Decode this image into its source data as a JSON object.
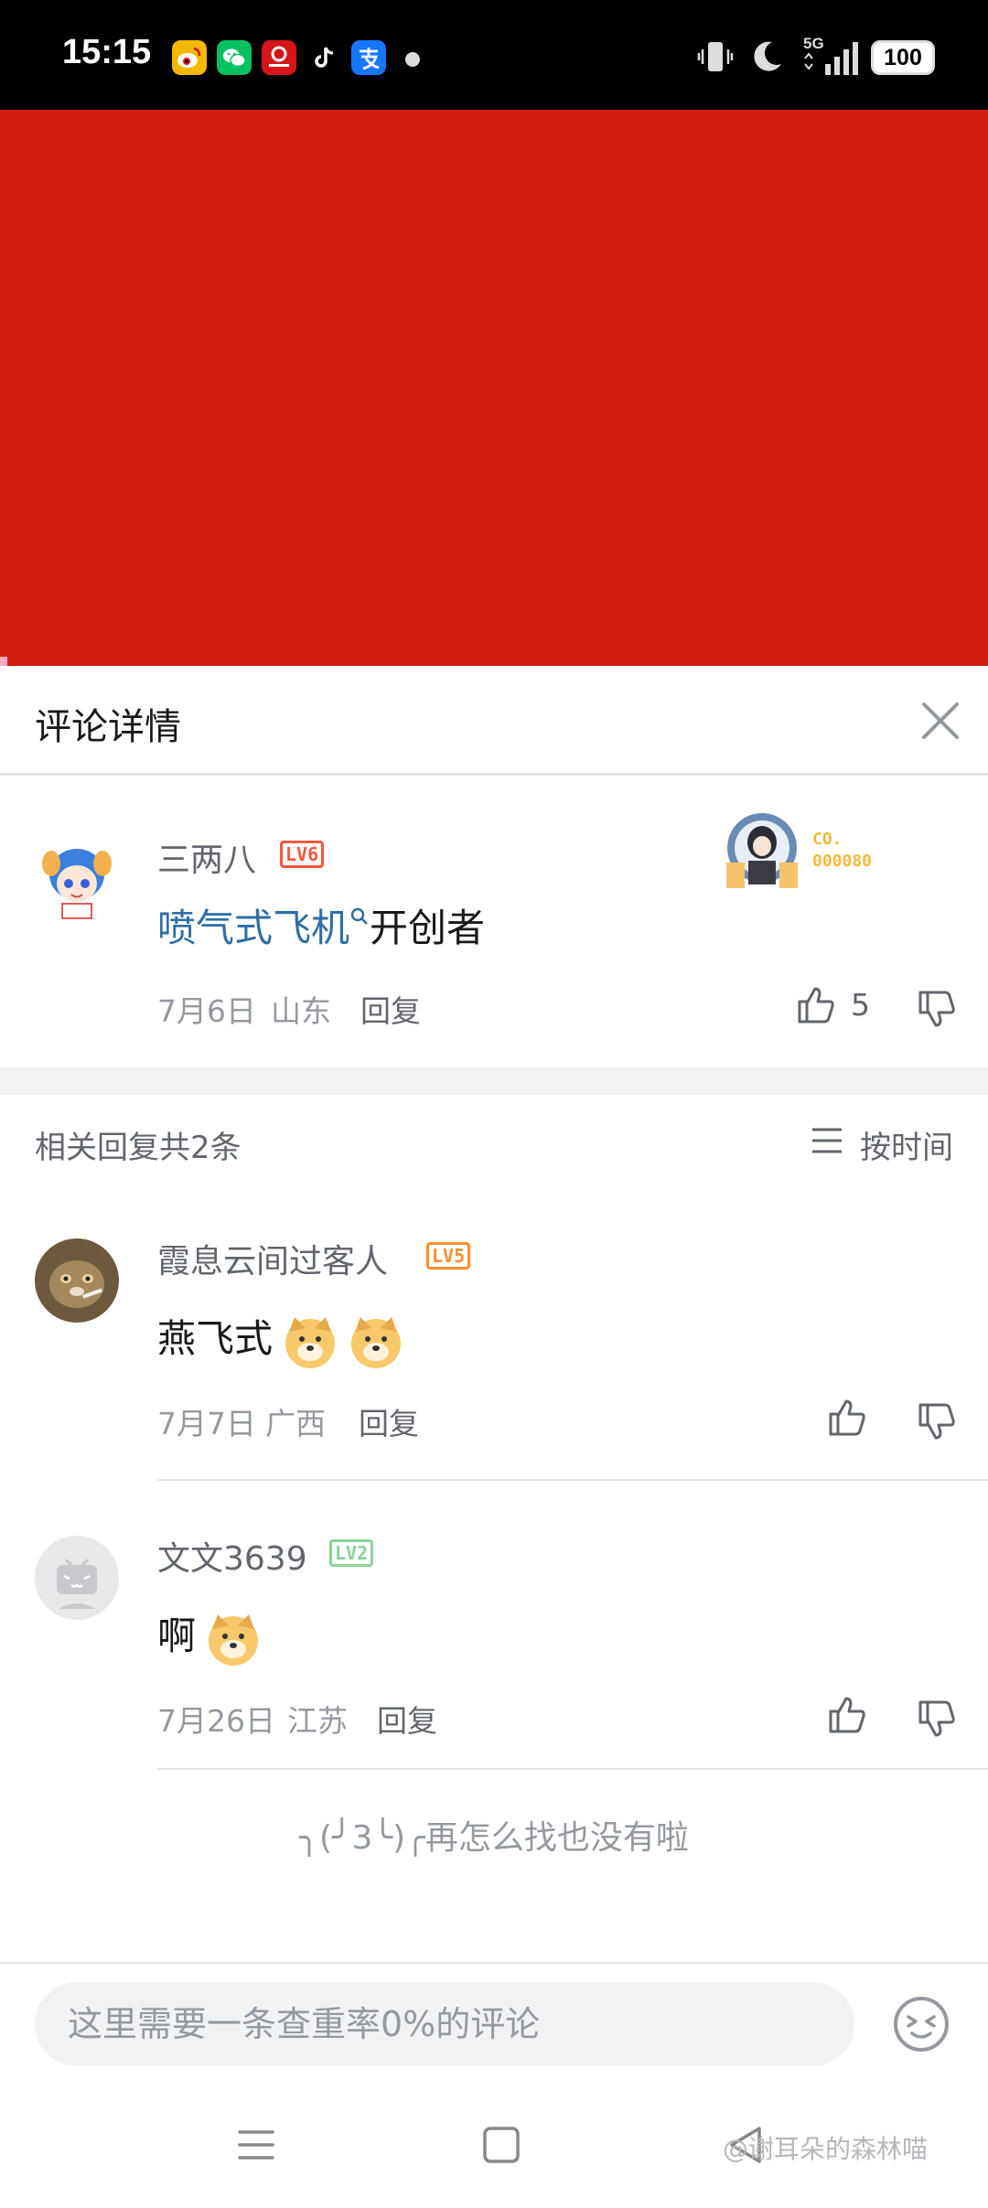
{
  "status_bar": {
    "time": "15:15",
    "network": "5G",
    "battery": "100",
    "app_icons": [
      {
        "name": "weibo-icon",
        "color": "#f5b800"
      },
      {
        "name": "wechat-icon",
        "color": "#07c160"
      },
      {
        "name": "news-app-icon",
        "color": "#d7141a"
      },
      {
        "name": "tiktok-icon",
        "color": "#000000"
      },
      {
        "name": "alipay-icon",
        "color": "#1677ff"
      }
    ]
  },
  "banner": {
    "color": "#d11a10"
  },
  "panel": {
    "title": "评论详情"
  },
  "main_comment": {
    "username": "三两八",
    "level": "LV6",
    "text_link": "喷气式飞机",
    "text_rest": "开创者",
    "date": "7月6日",
    "location": "山东",
    "reply_label": "回复",
    "likes": "5",
    "badge_text_1": "CO.",
    "badge_text_2": "000080"
  },
  "replies_header": {
    "count_text": "相关回复共2条",
    "sort_label": "按时间"
  },
  "replies": [
    {
      "username": "霞息云间过客人",
      "level": "LV5",
      "text": "燕飞式",
      "date": "7月7日",
      "location": "广西",
      "reply_label": "回复"
    },
    {
      "username": "文文3639",
      "level": "LV2",
      "text": "啊",
      "date": "7月26日",
      "location": "江苏",
      "reply_label": "回复"
    }
  ],
  "end_text": "╮(╯3╰)╭再怎么找也没有啦",
  "input": {
    "placeholder": "这里需要一条查重率0%的评论"
  },
  "watermark": "@谢耳朵的森林喵",
  "colors": {
    "lv6": "#f6563e",
    "lv5": "#ff8e29",
    "lv2": "#8bd29b",
    "link": "#2e6ea5"
  }
}
